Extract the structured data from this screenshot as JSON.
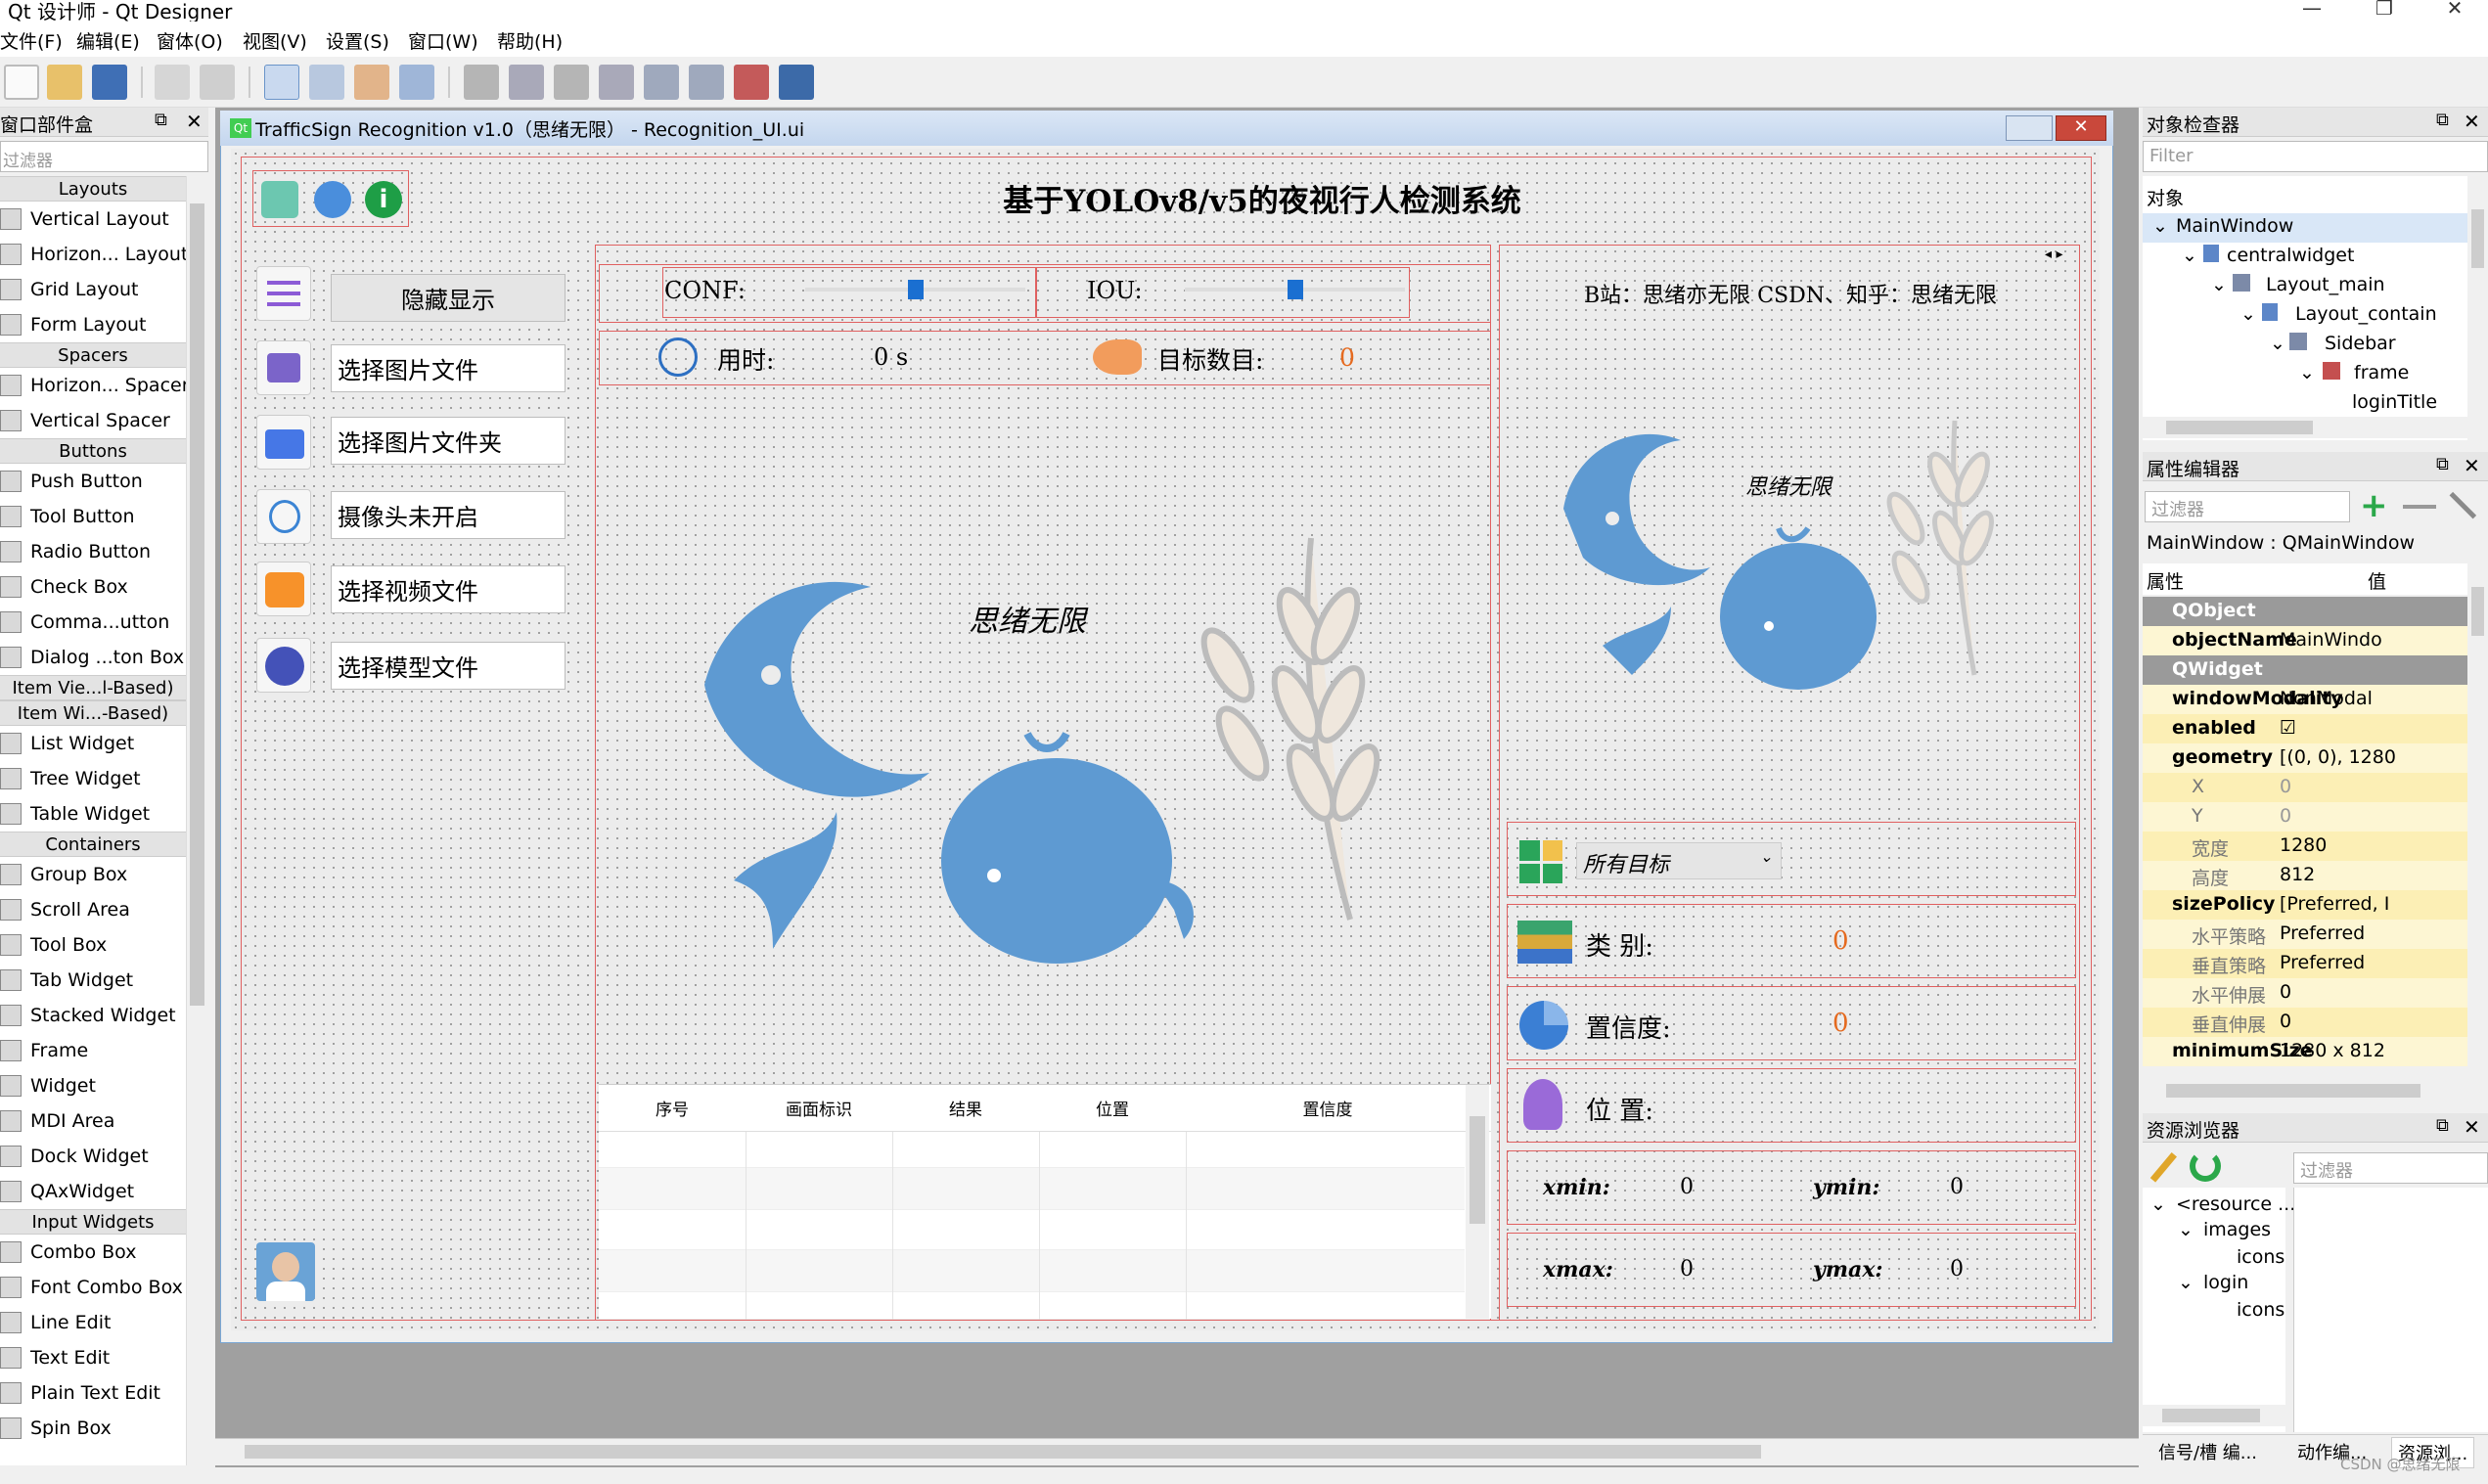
{
  "window": {
    "title": "Qt 设计师 - Qt Designer"
  },
  "menu": [
    "文件(F)",
    "编辑(E)",
    "窗体(O)",
    "视图(V)",
    "设置(S)",
    "窗口(W)",
    "帮助(H)"
  ],
  "widget_box": {
    "title": "窗口部件盒",
    "filter_placeholder": "过滤器",
    "categories": [
      {
        "name": "Layouts",
        "items": [
          "Vertical Layout",
          "Horizon... Layout",
          "Grid Layout",
          "Form Layout"
        ]
      },
      {
        "name": "Spacers",
        "items": [
          "Horizon... Spacer",
          "Vertical Spacer"
        ]
      },
      {
        "name": "Buttons",
        "items": [
          "Push Button",
          "Tool Button",
          "Radio Button",
          "Check Box",
          "Comma...utton",
          "Dialog ...ton Box"
        ]
      },
      {
        "name": "Item Vie...l-Based)",
        "items": []
      },
      {
        "name": "Item Wi...-Based)",
        "items": [
          "List Widget",
          "Tree Widget",
          "Table Widget"
        ]
      },
      {
        "name": "Containers",
        "items": [
          "Group Box",
          "Scroll Area",
          "Tool Box",
          "Tab Widget",
          "Stacked Widget",
          "Frame",
          "Widget",
          "MDI Area",
          "Dock Widget",
          "QAxWidget"
        ]
      },
      {
        "name": "Input Widgets",
        "items": [
          "Combo Box",
          "Font Combo Box",
          "Line Edit",
          "Text Edit",
          "Plain Text Edit",
          "Spin Box"
        ]
      }
    ]
  },
  "form": {
    "title": "TrafficSign Recognition v1.0（思绪无限） - Recognition_UI.ui",
    "heading": "基于YOLOv8/v5的夜视行人检测系统",
    "sidebar": [
      "隐藏显示",
      "选择图片文件",
      "选择图片文件夹",
      "摄像头未开启",
      "选择视频文件",
      "选择模型文件"
    ],
    "conf_label": "CONF:",
    "iou_label": "IOU:",
    "conf_value": 0.5,
    "iou_value": 0.5,
    "time_label": "用时:",
    "time_value": "0 s",
    "count_label": "目标数目:",
    "count_value": "0",
    "logo_text": "思绪无限",
    "table_headers": [
      "序号",
      "画面标识",
      "结果",
      "位置",
      "置信度"
    ],
    "credit": "B站：思绪亦无限 CSDN、知乎：思绪无限",
    "target_select": "所有目标",
    "class_label": "类 别:",
    "class_value": "0",
    "conf2_label": "置信度:",
    "conf2_value": "0",
    "pos_label": "位 置:",
    "xmin_label": "xmin:",
    "xmin_value": "0",
    "ymin_label": "ymin:",
    "ymin_value": "0",
    "xmax_label": "xmax:",
    "xmax_value": "0",
    "ymax_label": "ymax:",
    "ymax_value": "0"
  },
  "object_inspector": {
    "title": "对象检查器",
    "filter_placeholder": "Filter",
    "col": "对象",
    "tree": [
      "MainWindow",
      "centralwidget",
      "Layout_main",
      "Layout_contain",
      "Sidebar",
      "frame",
      "loginTitle"
    ]
  },
  "property_editor": {
    "title": "属性编辑器",
    "filter_placeholder": "过滤器",
    "object": "MainWindow : QMainWindow",
    "col_prop": "属性",
    "col_val": "值",
    "rows": [
      {
        "k": "QObject",
        "v": "",
        "section": true
      },
      {
        "k": "objectName",
        "v": "MainWindo"
      },
      {
        "k": "QWidget",
        "v": "",
        "section": true
      },
      {
        "k": "windowModality",
        "v": "NonModal"
      },
      {
        "k": "enabled",
        "v": "☑"
      },
      {
        "k": "geometry",
        "v": "[(0, 0), 1280"
      },
      {
        "k": "X",
        "v": "0"
      },
      {
        "k": "Y",
        "v": "0"
      },
      {
        "k": "宽度",
        "v": "1280"
      },
      {
        "k": "高度",
        "v": "812"
      },
      {
        "k": "sizePolicy",
        "v": "[Preferred, I"
      },
      {
        "k": "水平策略",
        "v": "Preferred"
      },
      {
        "k": "垂直策略",
        "v": "Preferred"
      },
      {
        "k": "水平伸展",
        "v": "0"
      },
      {
        "k": "垂直伸展",
        "v": "0"
      },
      {
        "k": "minimumSize",
        "v": "1280 x 812"
      }
    ]
  },
  "resource_browser": {
    "title": "资源浏览器",
    "filter_placeholder": "过滤器",
    "tree": [
      "<resource ...",
      "images",
      "icons",
      "login",
      "icons"
    ],
    "tabs": [
      "信号/槽 编...",
      "动作编...",
      "资源浏..."
    ]
  },
  "watermark": "CSDN @思绪无限"
}
